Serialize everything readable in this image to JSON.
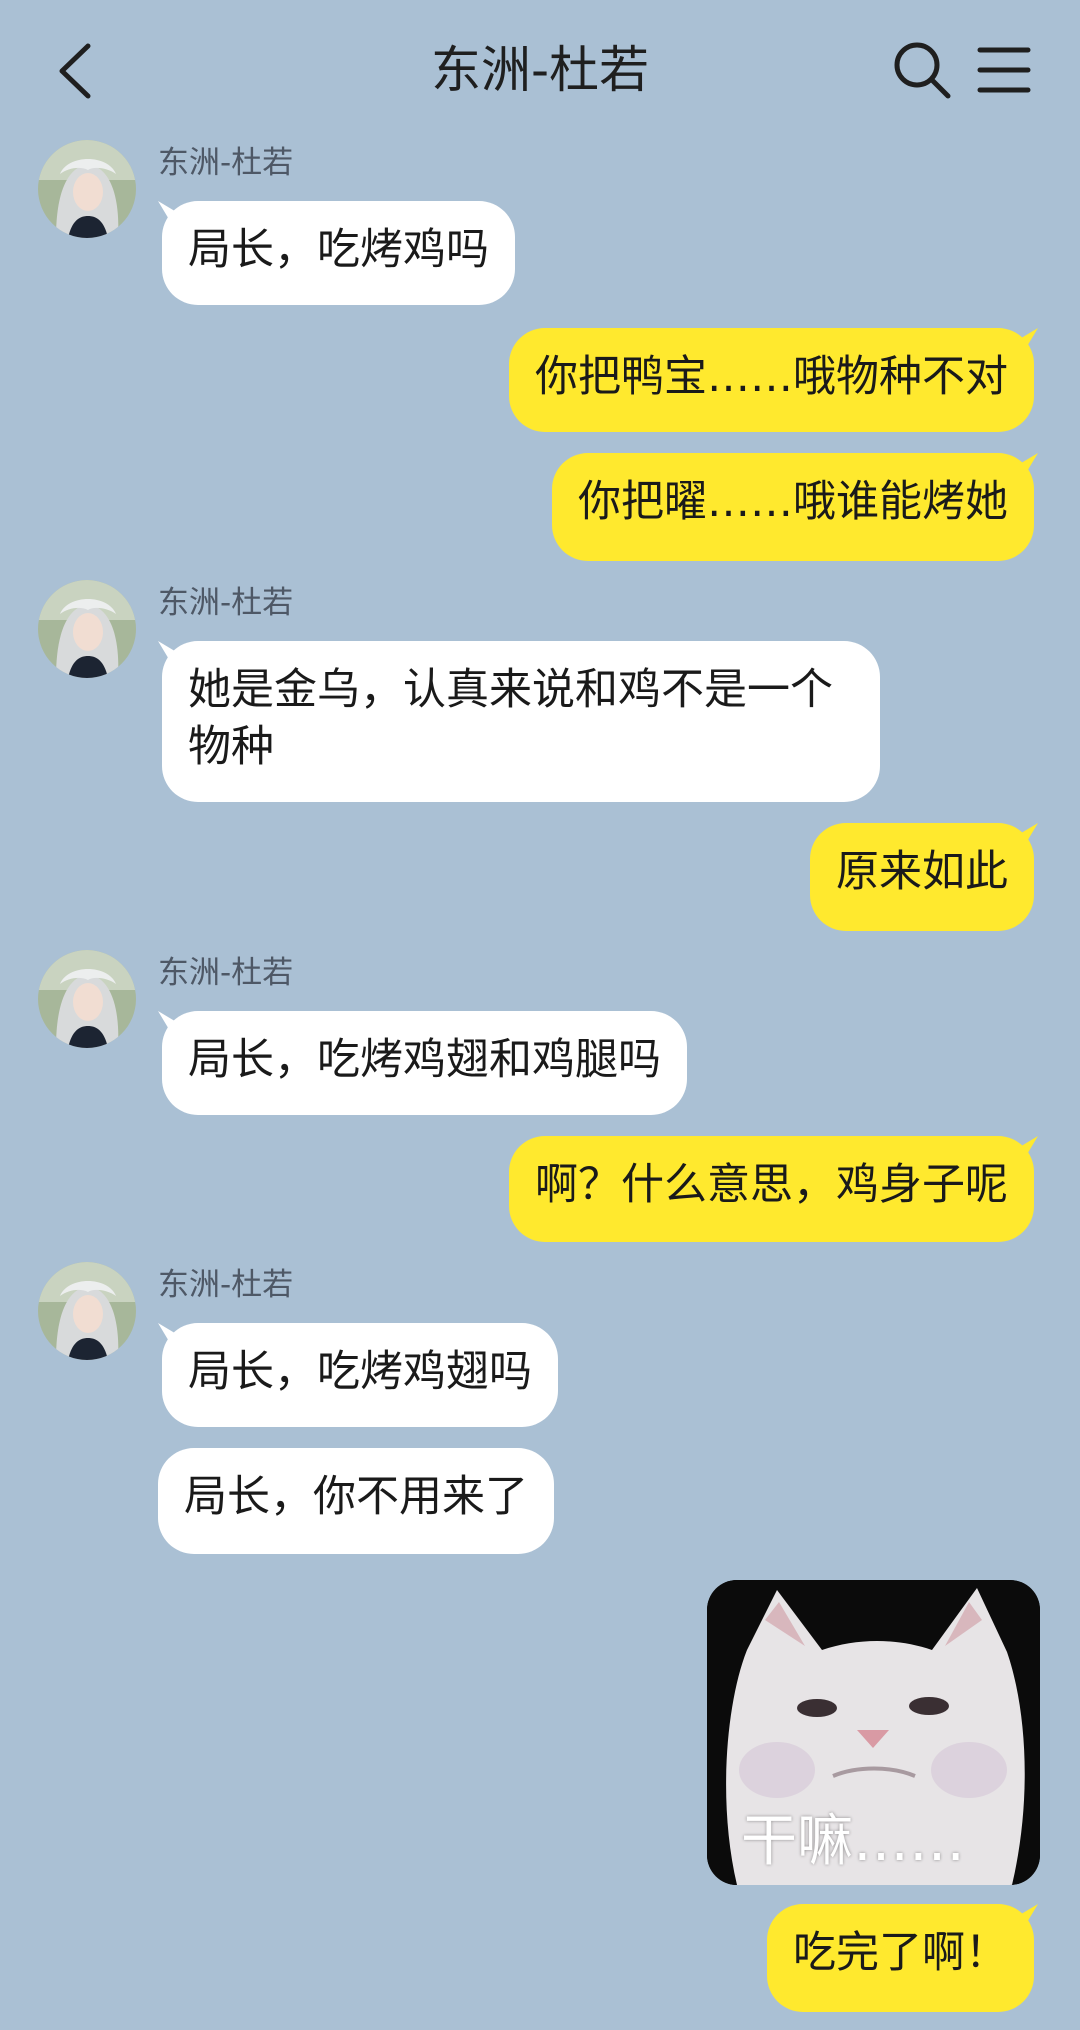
{
  "header": {
    "title": "东洲-杜若",
    "back_icon": "chevron-left-icon",
    "search_icon": "search-icon",
    "menu_icon": "menu-icon"
  },
  "colors": {
    "background": "#aac0d4",
    "incoming_bubble": "#ffffff",
    "outgoing_bubble": "#ffe92e"
  },
  "messages": [
    {
      "side": "in",
      "sender": "东洲-杜若",
      "text": "局长，吃烤鸡吗"
    },
    {
      "side": "out",
      "text": "你把鸭宝……哦物种不对"
    },
    {
      "side": "out",
      "text": "你把曜……哦谁能烤她"
    },
    {
      "side": "in",
      "sender": "东洲-杜若",
      "text": "她是金乌，认真来说和鸡不是一个物种"
    },
    {
      "side": "out",
      "text": "原来如此"
    },
    {
      "side": "in",
      "sender": "东洲-杜若",
      "text": "局长，吃烤鸡翅和鸡腿吗"
    },
    {
      "side": "out",
      "text": "啊？什么意思，鸡身子呢"
    },
    {
      "side": "in",
      "sender": "东洲-杜若",
      "text": "局长，吃烤鸡翅吗"
    },
    {
      "side": "in",
      "text": "局长，你不用来了"
    },
    {
      "side": "out",
      "type": "sticker",
      "caption": "干嘛……"
    },
    {
      "side": "out",
      "text": "吃完了啊！"
    }
  ]
}
